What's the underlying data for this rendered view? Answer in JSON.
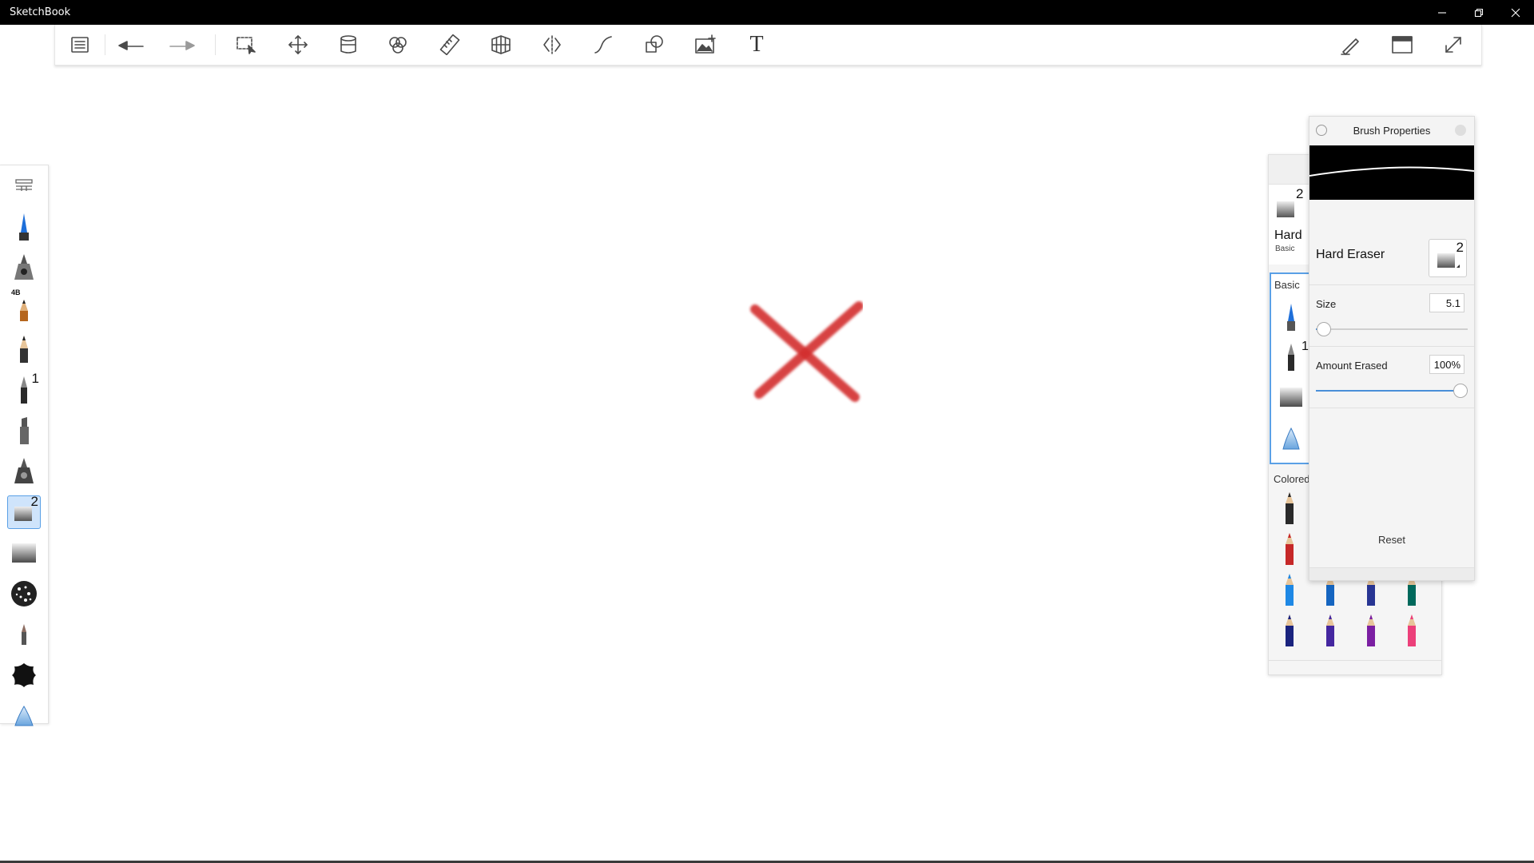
{
  "app": {
    "title": "SketchBook"
  },
  "window_controls": [
    "minimize-icon",
    "restore-icon",
    "close-icon"
  ],
  "toolbar": {
    "tools": [
      {
        "id": "lagoon",
        "icon": "list-icon"
      },
      {
        "id": "undo",
        "icon": "undo-icon"
      },
      {
        "id": "redo",
        "icon": "redo-icon"
      },
      {
        "id": "select",
        "icon": "selection-icon"
      },
      {
        "id": "transform",
        "icon": "move-icon"
      },
      {
        "id": "layers",
        "icon": "layers-icon"
      },
      {
        "id": "color-editor",
        "icon": "color-circles-icon"
      },
      {
        "id": "ruler",
        "icon": "ruler-icon"
      },
      {
        "id": "perspective",
        "icon": "perspective-grid-icon"
      },
      {
        "id": "symmetry",
        "icon": "symmetry-icon"
      },
      {
        "id": "stroke",
        "icon": "curve-icon"
      },
      {
        "id": "shapes",
        "icon": "shapes-icon"
      },
      {
        "id": "import-image",
        "icon": "add-image-icon"
      },
      {
        "id": "text",
        "icon": "text-icon",
        "label": "T"
      }
    ],
    "right_tools": [
      {
        "id": "brush-toggle",
        "icon": "pen-icon"
      },
      {
        "id": "ui-toggle",
        "icon": "window-icon"
      },
      {
        "id": "fullscreen",
        "icon": "expand-icon"
      }
    ]
  },
  "left_palette": {
    "items": [
      {
        "icon": "palette-menu-icon"
      },
      {
        "icon": "pen-blue-icon"
      },
      {
        "icon": "airbrush-icon"
      },
      {
        "icon": "pencil-4b-icon",
        "tag": "4B"
      },
      {
        "icon": "pencil-icon"
      },
      {
        "icon": "ballpoint-pen-icon",
        "badge": "1"
      },
      {
        "icon": "marker-icon"
      },
      {
        "icon": "airbrush-gray-icon"
      },
      {
        "icon": "hard-eraser-icon",
        "badge": "2",
        "selected": true
      },
      {
        "icon": "soft-eraser-icon"
      },
      {
        "icon": "texture-brush-icon"
      },
      {
        "icon": "smudge-icon"
      },
      {
        "icon": "ink-splat-icon"
      },
      {
        "icon": "blender-icon"
      }
    ]
  },
  "brush_library": {
    "current_name": "Hard",
    "current_set": "Basic",
    "current_badge": "2",
    "sections": [
      {
        "label": "Basic",
        "badge_on_second": "1"
      },
      {
        "label": "Colored"
      }
    ],
    "colored_pencils": [
      "#2a2a2a",
      "#c62828",
      "#1e88e5",
      "#1565c0",
      "#283593",
      "#00695c",
      "#1a237e",
      "#4527a0",
      "#7b1fa2",
      "#ec407a"
    ]
  },
  "brush_properties": {
    "title": "Brush Properties",
    "brush_name": "Hard Eraser",
    "thumb_badge": "2",
    "size": {
      "label": "Size",
      "value": "5.1",
      "fraction": 0.05
    },
    "amount": {
      "label": "Amount Erased",
      "value": "100%",
      "fraction": 1.0
    },
    "reset_label": "Reset"
  },
  "canvas": {
    "mark_color": "#d32f2f"
  }
}
